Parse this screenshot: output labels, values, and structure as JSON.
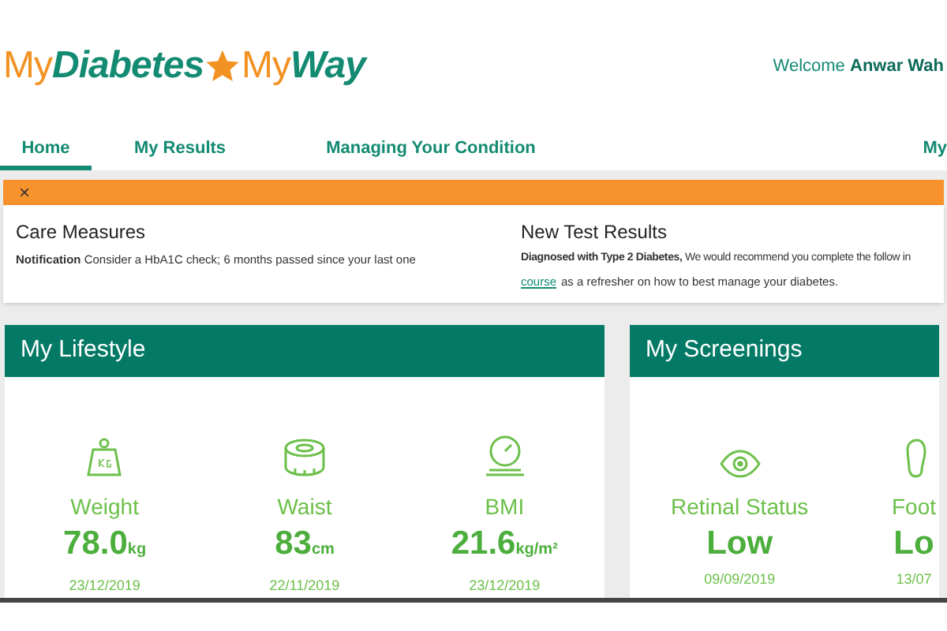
{
  "logo": {
    "part_1": "My",
    "part_2": "Diabetes",
    "part_3": "My",
    "part_4": "Way"
  },
  "welcome": {
    "greeting": "Welcome",
    "name": "Anwar Wah"
  },
  "tabs": [
    {
      "label": "Home",
      "selected": true
    },
    {
      "label": "My Results",
      "selected": false
    },
    {
      "label": "Managing Your Condition",
      "selected": false
    },
    {
      "label": "My",
      "selected": false
    }
  ],
  "alert": {
    "close": "×"
  },
  "notices": [
    {
      "title": "Care Measures",
      "text": "**Notification** Consider a HbA1C check; 6 months passed since your last one"
    },
    {
      "title": "New Test Results",
      "text": "**Diagnosed with Type 2 Diabetes,** We would recommend you complete the follow in",
      "link": "course",
      "after": "as a refresher on how to best manage your diabetes."
    }
  ],
  "cards": [
    {
      "title": "My Lifestyle",
      "items": [
        {
          "kind": "weight",
          "label": "Weight",
          "value": "78.0",
          "unit": "kg",
          "date": "23/12/2019"
        },
        {
          "kind": "waist",
          "label": "Waist",
          "value": "83",
          "unit": "cm",
          "date": "22/11/2019"
        },
        {
          "kind": "bmi",
          "label": "BMI",
          "value": "21.6",
          "unit": "kg/m²",
          "date": "23/12/2019"
        }
      ]
    },
    {
      "title": "My Screenings",
      "items": [
        {
          "kind": "eye",
          "label": "Retinal Status",
          "value": "Low",
          "date": "09/09/2019"
        },
        {
          "kind": "foot",
          "label": "Foot",
          "value": "Lo",
          "date": "13/07"
        }
      ]
    }
  ]
}
